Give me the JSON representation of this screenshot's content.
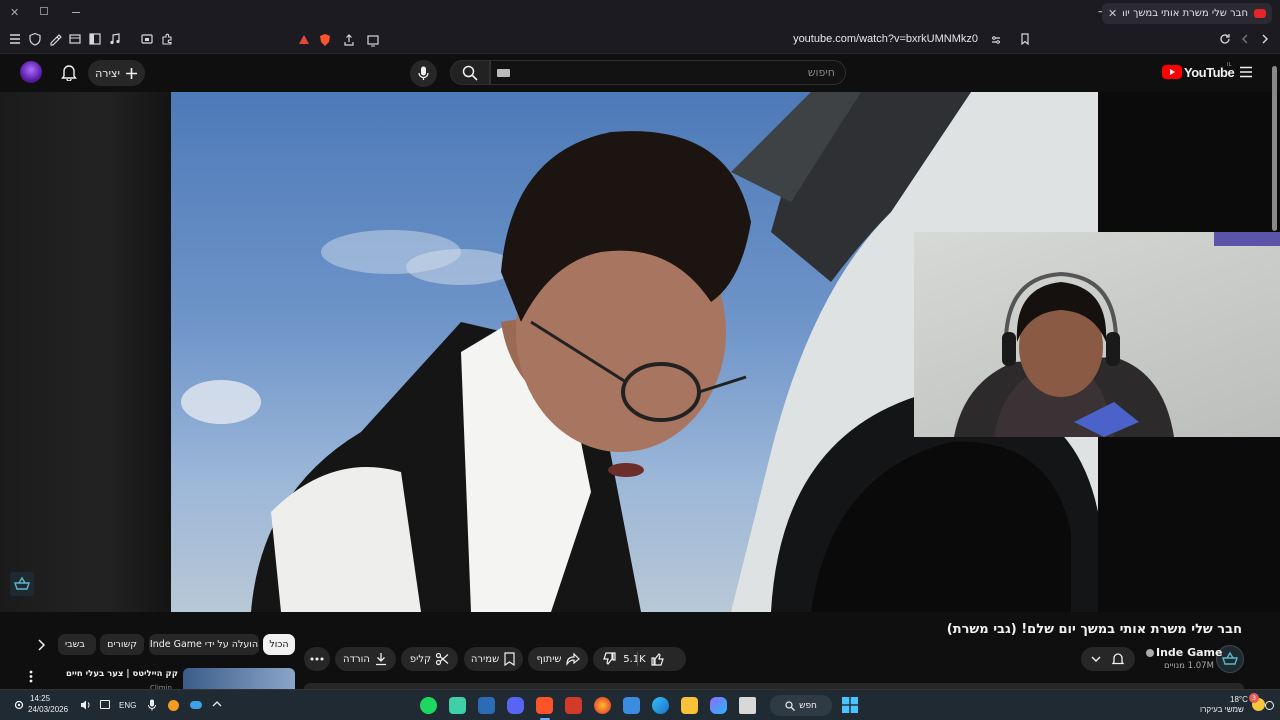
{
  "browser": {
    "tab_title": "חבר שלי משרת אותי במשך יום ש",
    "url": "youtube.com/watch?v=bxrkUMNMkz0",
    "new_tab": "+"
  },
  "youtube": {
    "logo_text": "YouTube",
    "logo_region": "IL",
    "search_placeholder": "חיפוש",
    "create_label": "יצירה"
  },
  "video": {
    "title": "חבר שלי משרת אותי במשך יום שלם! (גבי משרת)",
    "channel_name": "Inde Game",
    "subscribers": "1.07M מנויים",
    "likes": "5.1K",
    "share_label": "שיתוף",
    "save_label": "שמירה",
    "clip_label": "קליפ",
    "download_label": "הורדה"
  },
  "related": {
    "chips": [
      "הכול",
      "הועלה על ידי Inde Game",
      "קשורים",
      "בשבי"
    ],
    "first_title": "קק הייליטס | צער בעלי חיים",
    "first_channel": "Climin"
  },
  "taskbar": {
    "time": "14:25",
    "date": "24/03/2026",
    "lang": "ENG",
    "search_label": "חפש",
    "weather_temp": "18°C",
    "weather_desc": "שמשי בעיקרו",
    "notif_badge": "3"
  },
  "colors": {
    "bg": "#0f0f0f",
    "youtube_red": "#ff0000",
    "brave_orange": "#fb542b"
  }
}
